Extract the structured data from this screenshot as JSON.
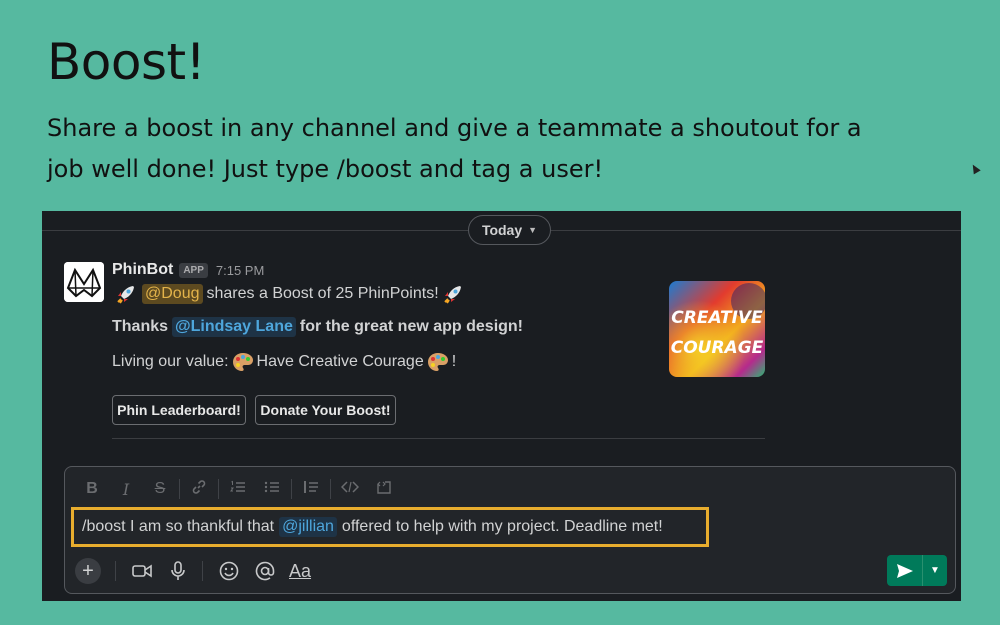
{
  "hero": {
    "title": "Boost!",
    "description": "Share a boost in any channel and give a teammate a shoutout for a job well done! Just type /boost and tag a user!"
  },
  "channel": {
    "date_divider": "Today"
  },
  "message": {
    "bot_name": "PhinBot",
    "badge": "APP",
    "time": "7:15 PM",
    "line1": {
      "mention": "@Doug",
      "text": "shares a Boost of 25 PhinPoints!"
    },
    "line2": {
      "prefix": "Thanks",
      "mention": "@Lindsay Lane",
      "suffix": "for the great new app design!"
    },
    "line3": {
      "prefix": "Living our value:",
      "value": "Have Creative Courage",
      "suffix": "!"
    },
    "image_text": [
      "CREATIVE",
      "COURAGE"
    ],
    "buttons": {
      "leaderboard": "Phin Leaderboard!",
      "donate": "Donate Your Boost!"
    }
  },
  "composer": {
    "text_before": "/boost I am so thankful that",
    "mention": "@jillian",
    "text_after": "offered to help with my project. Deadline met!",
    "aa_label": "Aa"
  },
  "colors": {
    "page_bg": "#56b9a0",
    "slack_bg": "#1a1d21",
    "highlight": "#e8ad2e",
    "send": "#007a5a",
    "mention_blue": "#4ea6dc",
    "mention_yellow": "#e3b34a"
  }
}
